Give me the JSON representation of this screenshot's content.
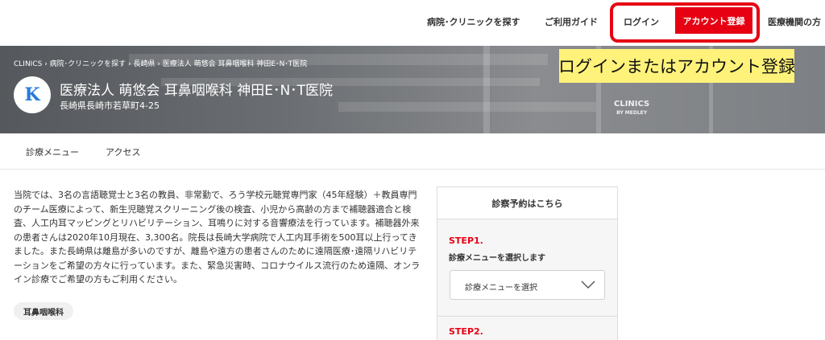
{
  "topnav": {
    "find_clinic": "病院･クリニックを探す",
    "guide": "ご利用ガイド",
    "login": "ログイン",
    "register": "アカウント登録",
    "medical": "医療機関の方"
  },
  "callout": "ログインまたはアカウント登録",
  "breadcrumb": "CLINICS › 病院･クリニックを探す › 長崎県 › 医療法人 萌悠会 耳鼻咽喉科 神田E･N･T医院",
  "clinic": {
    "logo_letter": "K",
    "name": "医療法人 萌悠会 耳鼻咽喉科 神田E･N･T医院",
    "address": "長崎県長崎市若草町4-25"
  },
  "hero_sign": {
    "line1": "CLINICS",
    "line2": "BY MEDLEY"
  },
  "tabs": [
    {
      "label": "診療メニュー"
    },
    {
      "label": "アクセス"
    }
  ],
  "description": "当院では、3名の言語聴覚士と3名の教員、非常勤で、ろう学校元聴覚専門家（45年経験）＋教員専門のチーム医療によって、新生児聴覚スクリーニング後の検査、小児から高齢の方まで補聴器適合と検査、人工内耳マッピングとリハビリテーション、耳鳴りに対する音響療法を行っています。補聴器外来の患者さんは2020年10月現在、3,300名。院長は長崎大学病院で人工内耳手術を500耳以上行ってきました。また長崎県は離島が多いのですが、離島や遠方の患者さんのために遠隔医療･遠隔リハビリテーションをご希望の方々に行っています。また、緊急災害時、コロナウイルス流行のため遠隔、オンライン診療でご希望の方もご利用ください。",
  "tag": "耳鼻咽喉科",
  "booking": {
    "title": "診察予約はこちら",
    "step1_label": "STEP1.",
    "step1_desc": "診療メニューを選択します",
    "select_placeholder": "診療メニューを選択",
    "step2_label": "STEP2."
  },
  "colors": {
    "accent": "#e60012",
    "callout": "#fff27a",
    "logo": "#2a7bd8"
  }
}
